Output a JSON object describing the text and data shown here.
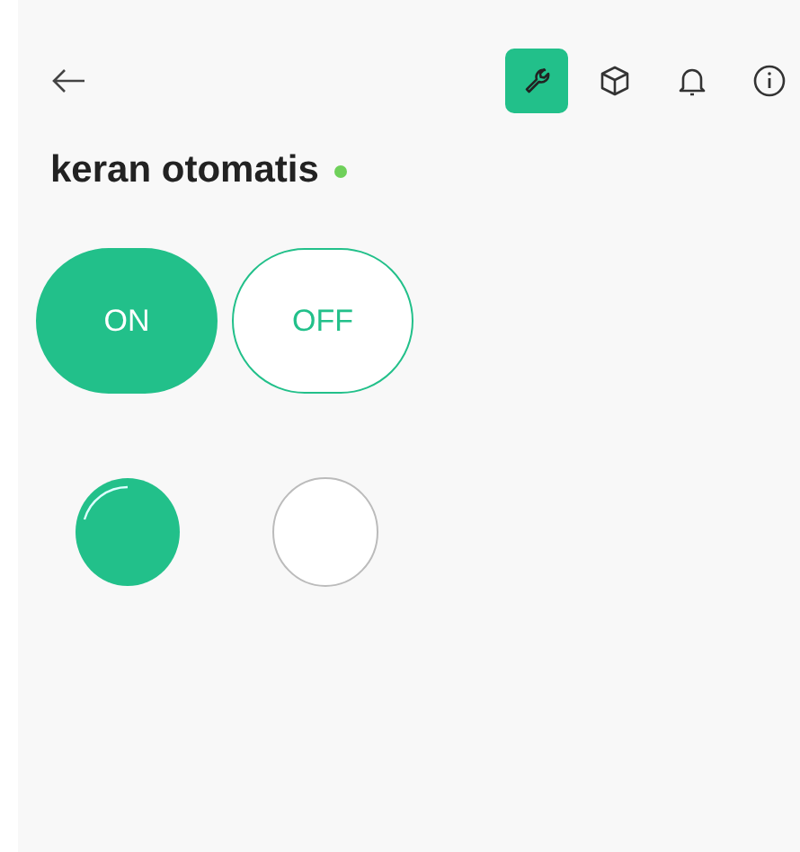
{
  "header": {
    "tools": [
      {
        "kind": "wrench",
        "selected": true
      },
      {
        "kind": "cube",
        "selected": false
      },
      {
        "kind": "bell",
        "selected": false
      },
      {
        "kind": "info",
        "selected": false
      }
    ]
  },
  "device": {
    "name": "keran otomatis",
    "online": true
  },
  "switches": [
    {
      "label": "ON",
      "selected": true
    },
    {
      "label": "OFF",
      "selected": false
    }
  ],
  "indicators": [
    {
      "on": true
    },
    {
      "on": false
    }
  ]
}
